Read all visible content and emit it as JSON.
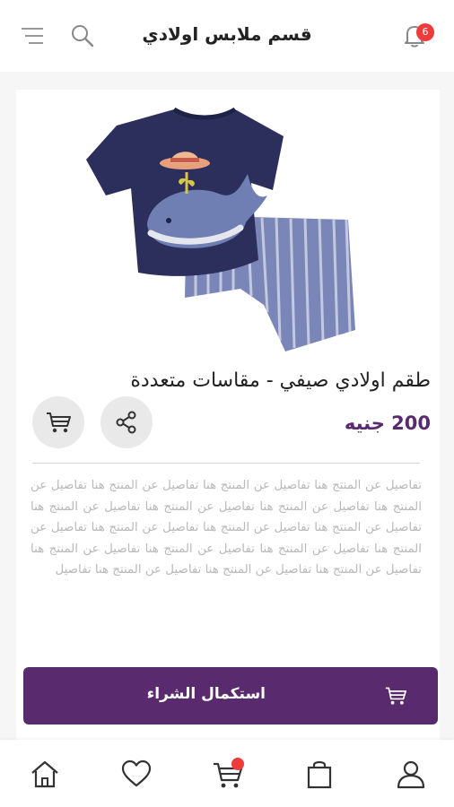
{
  "header": {
    "title": "قسم ملابس اولادي",
    "notification_count": "6",
    "icons": {
      "menu": "hamburger-menu-icon",
      "search": "search-icon",
      "bell": "bell-icon"
    }
  },
  "product": {
    "image": "kids-tshirt-shorts-set-image",
    "name": "طقم اولادي صيفي - مقاسات متعددة",
    "price": "200 جنيه",
    "description": "تفاصيل عن المنتج هنا تفاصيل عن المنتج هنا تفاصيل عن المنتج هنا تفاصيل عن المنتج هنا تفاصيل عن المنتج هنا  تفاصيل عن المنتج هنا تفاصيل عن المنتج هنا  تفاصيل عن المنتج هنا تفاصيل عن المنتج هنا تفاصيل عن المنتج هنا تفاصيل عن المنتج هنا تفاصيل عن المنتج هنا  تفاصيل عن المنتج هنا تفاصيل عن المنتج هنا تفاصيل عن المنتج هنا تفاصيل عن المنتج هنا تفاصيل عن المنتج هنا تفاصيل"
  },
  "actions": {
    "share_icon": "share-icon",
    "cart_icon": "cart-icon"
  },
  "checkout": {
    "label": "استكمال الشراء"
  },
  "bottom_nav": {
    "items": [
      "home-icon",
      "heart-icon",
      "cart-icon",
      "shopping-bag-icon",
      "user-icon"
    ],
    "cart_badge": true
  },
  "colors": {
    "accent": "#5a2a6e",
    "badge": "#ef3b3b",
    "background": "#f6f6f6"
  }
}
